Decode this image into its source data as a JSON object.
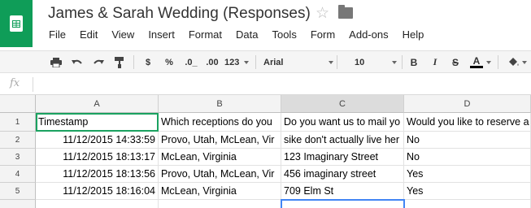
{
  "app": {
    "title": "James & Sarah Wedding  (Responses)",
    "logo_icon": "sheets-logo-icon",
    "star_icon": "☆",
    "folder_icon": "folder-icon"
  },
  "menu": [
    "File",
    "Edit",
    "View",
    "Insert",
    "Format",
    "Data",
    "Tools",
    "Form",
    "Add-ons",
    "Help"
  ],
  "toolbar": {
    "currency": "$",
    "percent": "%",
    "dec_decrease": ".0_",
    "dec_increase": ".00",
    "more_formats": "123",
    "font": "Arial",
    "font_size": "10",
    "bold": "B",
    "italic": "I",
    "strike": "S",
    "text_color": "A"
  },
  "formula_bar": {
    "fx_label": "fx",
    "value": ""
  },
  "columns": [
    "A",
    "B",
    "C",
    "D"
  ],
  "rows": [
    "1",
    "2",
    "3",
    "4",
    "5"
  ],
  "cells": [
    [
      "Timestamp",
      "Which receptions do you",
      "Do you want us to mail yo",
      "Would you like to reserve a"
    ],
    [
      "11/12/2015 14:33:59",
      "Provo, Utah, McLean, Vir",
      "sike don't actually live her",
      "No"
    ],
    [
      "11/12/2015 18:13:17",
      "McLean, Virginia",
      "123 Imaginary Street",
      "No"
    ],
    [
      "11/12/2015 18:13:56",
      "Provo, Utah, McLean, Vir",
      "456 imaginary street",
      "Yes"
    ],
    [
      "11/12/2015 18:16:04",
      "McLean, Virginia",
      "709 Elm St",
      "Yes"
    ]
  ],
  "colors": {
    "brand": "#0f9d58",
    "selection": "#4285f4"
  }
}
